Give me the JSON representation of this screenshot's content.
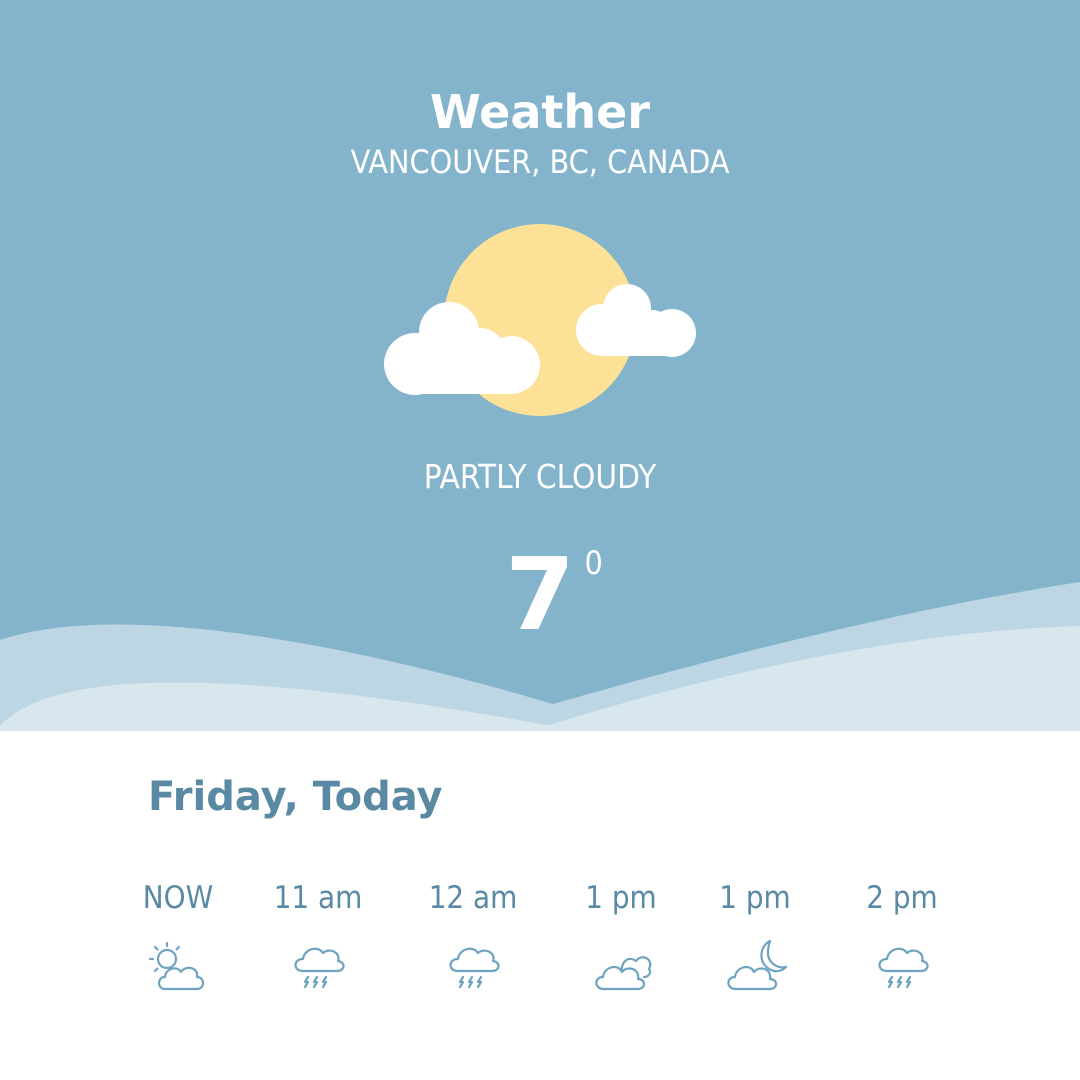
{
  "header": {
    "title": "Weather",
    "location": "VANCOUVER, BC, CANADA"
  },
  "current": {
    "icon": "partly-cloudy-icon",
    "condition": "PARTLY CLOUDY",
    "temperature": "7",
    "degree_mark": "0"
  },
  "forecast": {
    "day_label": "Friday, Today",
    "hours": [
      {
        "time": "NOW",
        "icon": "sun-cloud-icon"
      },
      {
        "time": "11 am",
        "icon": "thunderstorm-icon"
      },
      {
        "time": "12 am",
        "icon": "thunderstorm-icon"
      },
      {
        "time": "1 pm",
        "icon": "cloudy-icon"
      },
      {
        "time": "1 pm",
        "icon": "moon-cloud-icon"
      },
      {
        "time": "2 pm",
        "icon": "thunderstorm-icon"
      }
    ]
  },
  "colors": {
    "sky": "#84b4cc",
    "wave_light": "#bcd6e3",
    "wave_lighter": "#d8e6ee",
    "sun": "#fde196",
    "text_accent": "#5a8aa3",
    "icon_stroke": "#6fa4c0"
  }
}
